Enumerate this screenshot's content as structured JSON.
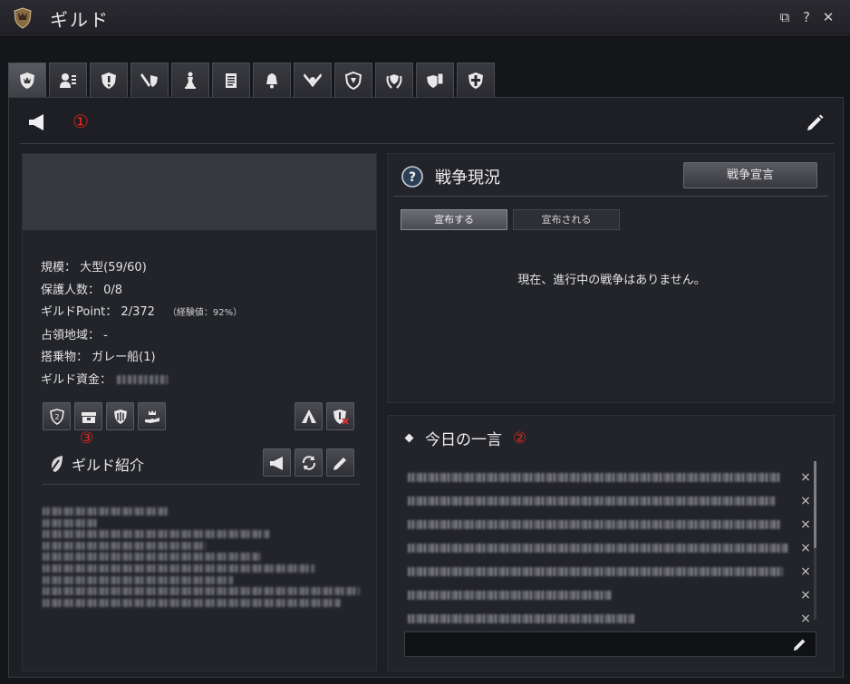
{
  "window": {
    "title": "ギルド",
    "emblem_icon": "guild-crest-icon",
    "controls": [
      "restore-icon",
      "help-icon",
      "close-icon"
    ],
    "control_glyphs": [
      "⧉",
      "?",
      "✕"
    ]
  },
  "tabs": [
    {
      "icon": "guild-emblem-icon",
      "active": true
    },
    {
      "icon": "member-list-icon"
    },
    {
      "icon": "alert-icon"
    },
    {
      "icon": "sword-shield-icon"
    },
    {
      "icon": "chess-piece-icon"
    },
    {
      "icon": "scroll-icon"
    },
    {
      "icon": "bell-icon"
    },
    {
      "icon": "crossed-swords-icon"
    },
    {
      "icon": "shield-icon"
    },
    {
      "icon": "laurel-emblem-icon"
    },
    {
      "icon": "shield-scroll-icon"
    },
    {
      "icon": "cross-shield-icon"
    }
  ],
  "notice": {
    "number_marker": "①",
    "icon": "megaphone-icon"
  },
  "guild_info": {
    "size_label": "規模：",
    "size_value": "大型(59/60)",
    "protected_label": "保護人数：",
    "protected_value": "0/8",
    "point_label": "ギルドPoint：",
    "point_value": "2/372",
    "point_extra": "（経験値：92%）",
    "territory_label": "占領地域：",
    "territory_value": "-",
    "vehicle_label": "搭乗物：",
    "vehicle_value": "ガレー船(1)",
    "funds_label": "ギルド資金："
  },
  "action_buttons_left": [
    "shield-2-icon",
    "storage-chest-icon",
    "claw-emblem-icon",
    "hand-crown-icon"
  ],
  "action_buttons_right": [
    "tent-icon",
    "shield-cancel-icon"
  ],
  "marker3": "③",
  "intro": {
    "title": "ギルド紹介",
    "icon": "guild-leaf-icon",
    "buttons": [
      "megaphone-icon",
      "refresh-icon",
      "pencil-icon"
    ]
  },
  "war": {
    "title": "戦争現況",
    "declare_button": "戦争宣言",
    "tab_declared": "宣布する",
    "tab_received": "宣布される",
    "empty_message": "現在、進行中の戦争はありません。"
  },
  "today": {
    "title": "今日の一言",
    "number_marker": "②",
    "message_count": 7,
    "delete_glyph": "×",
    "input_placeholder": ""
  },
  "colors": {
    "accent_red": "#e0281e",
    "panel_bg": "#232429",
    "window_bg": "#1e1f24"
  }
}
